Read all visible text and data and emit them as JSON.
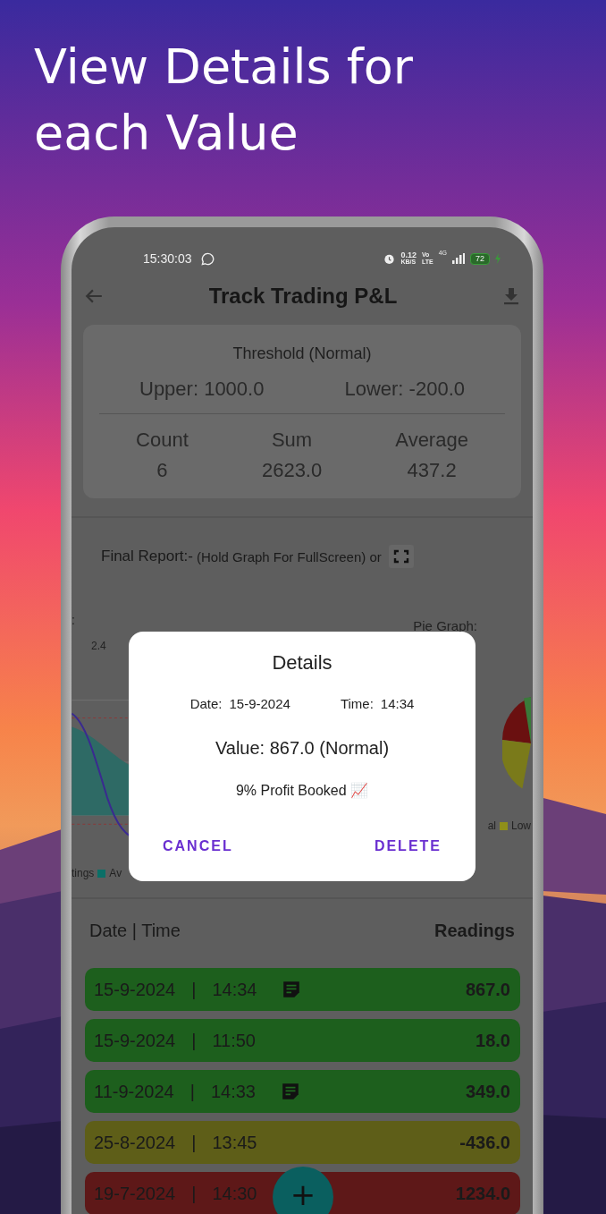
{
  "headline": "View Details for each Value",
  "status_bar": {
    "time": "15:30:03",
    "speed": "0.12",
    "speed_unit": "KB/S",
    "volte_top": "Vo",
    "volte_bottom": "LTE",
    "network": "4G",
    "battery": "72"
  },
  "app_bar": {
    "title": "Track Trading P&L"
  },
  "summary": {
    "threshold": "Threshold (Normal)",
    "upper": "Upper: 1000.0",
    "lower": "Lower: -200.0",
    "stats": [
      {
        "label": "Count",
        "value": "6"
      },
      {
        "label": "Sum",
        "value": "2623.0"
      },
      {
        "label": "Average",
        "value": "437.2"
      }
    ]
  },
  "report": {
    "label": "Final Report:-",
    "hint": "(Hold Graph For FullScreen) or"
  },
  "line_chart": {
    "title": ":",
    "tick": "2.4",
    "legend": [
      {
        "label": "tings"
      },
      {
        "label": "Av",
        "color": "#0b6f67"
      }
    ]
  },
  "pie_chart": {
    "title": "Pie Graph:",
    "legend": [
      {
        "label": "al"
      },
      {
        "label": "Low",
        "color": "#8f8f1a"
      }
    ]
  },
  "dialog": {
    "title": "Details",
    "date_label": "Date:",
    "date": "15-9-2024",
    "time_label": "Time:",
    "time": "14:34",
    "value": "Value:  867.0 (Normal)",
    "note": "9% Profit Booked 📈",
    "buttons": [
      {
        "label": "CANCEL"
      },
      {
        "label": "DELETE"
      }
    ]
  },
  "list": {
    "header_left": "Date  |  Time",
    "header_right": "Readings",
    "rows": [
      {
        "date": "15-9-2024",
        "separator": "|",
        "time": "14:34",
        "note": true,
        "reading": "867.0",
        "color": "#1d5f1d"
      },
      {
        "date": "15-9-2024",
        "separator": "|",
        "time": "11:50",
        "note": false,
        "reading": "18.0",
        "color": "#1d5f1d"
      },
      {
        "date": "11-9-2024",
        "separator": "|",
        "time": "14:33",
        "note": true,
        "reading": "349.0",
        "color": "#1d5f1d"
      },
      {
        "date": "25-8-2024",
        "separator": "|",
        "time": "13:45",
        "note": false,
        "reading": "-436.0",
        "color": "#5e5e18"
      },
      {
        "date": "19-7-2024",
        "separator": "|",
        "time": "14:30",
        "note": false,
        "reading": "1234.0",
        "color": "#5e1818"
      }
    ]
  },
  "fab": {
    "label": "+"
  }
}
